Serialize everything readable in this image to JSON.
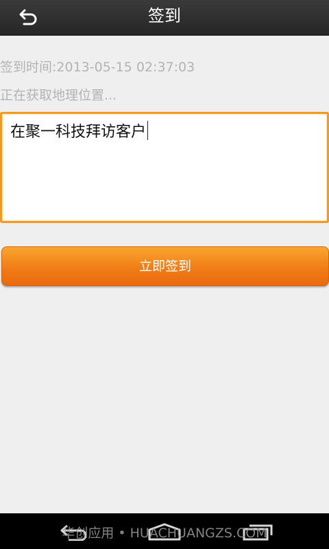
{
  "header": {
    "title": "签到",
    "back_icon": "back-arrow-icon"
  },
  "main": {
    "checkin_time": "签到时间:2013-05-15 02:37:03",
    "location_status": "正在获取地理位置...",
    "note_value": "在聚一科技拜访客户",
    "checkin_button_label": "立即签到"
  },
  "nav_bar": {
    "icons": [
      "back-icon",
      "home-icon",
      "recent-apps-icon"
    ]
  },
  "watermark": "华创应用 • HUACHUANGZS.COM",
  "colors": {
    "header_bg": "#2e2e2e",
    "accent_orange": "#f39a1e",
    "button_orange": "#f07d16",
    "hint_gray": "#b3b3b3"
  }
}
